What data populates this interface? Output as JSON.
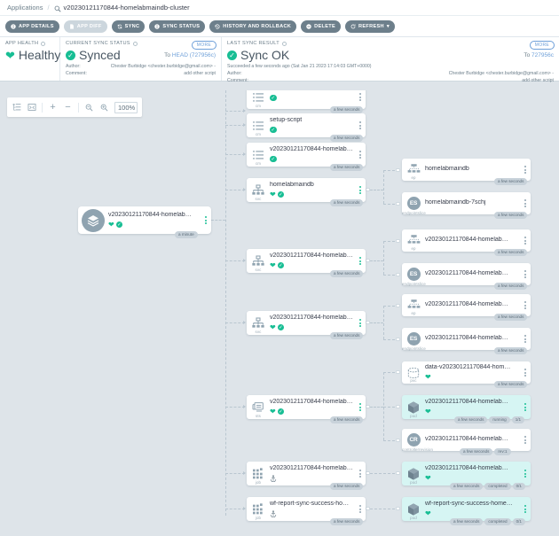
{
  "breadcrumb": {
    "root_label": "Applications",
    "separator": "/",
    "current": "v20230121170844-homelabmaindb-cluster",
    "search_icon": "magnifier-icon"
  },
  "toolbar": {
    "buttons": [
      {
        "label": "APP DETAILS",
        "icon": "info-icon",
        "disabled": false
      },
      {
        "label": "APP DIFF",
        "icon": "file-diff-icon",
        "disabled": true
      },
      {
        "label": "SYNC",
        "icon": "sync-icon",
        "disabled": false
      },
      {
        "label": "SYNC STATUS",
        "icon": "info-icon",
        "disabled": false
      },
      {
        "label": "HISTORY AND ROLLBACK",
        "icon": "history-icon",
        "disabled": false
      },
      {
        "label": "DELETE",
        "icon": "delete-icon",
        "disabled": false
      },
      {
        "label": "REFRESH",
        "icon": "refresh-icon",
        "disabled": false,
        "caret": "▾"
      }
    ]
  },
  "status": {
    "health": {
      "title": "APP HEALTH",
      "value": "Healthy",
      "icon": "heart-icon",
      "color": "#18be94"
    },
    "current_sync": {
      "title": "CURRENT SYNC STATUS",
      "more_label": "MORE",
      "value": "Synced",
      "icon": "check-circle-icon",
      "revision_prefix": "To",
      "revision": "HEAD (727956c)",
      "author_key": "Author:",
      "author_value": "Chester Burbidge <chester.burbidge@gmail.com> -",
      "comment_key": "Comment:",
      "comment_value": "add other script"
    },
    "last_sync": {
      "title": "LAST SYNC RESULT",
      "more_label": "MORE",
      "value": "Sync OK",
      "icon": "check-circle-icon",
      "revision_prefix": "To",
      "revision": "727956c",
      "succeeded": "Succeeded a few seconds ago (Sat Jan 21 2023 17:14:03 GMT+0000)",
      "author_key": "Author:",
      "author_value": "Chester Burbidge <chester.burbidge@gmail.com> -",
      "comment_key": "Comment:",
      "comment_value": "add other script"
    }
  },
  "zoombar": {
    "tree_icon": "tree-layout-icon",
    "fit_icon": "fit-to-screen-icon",
    "plus": "+",
    "minus": "−",
    "zoom_out_icon": "zoom-out-icon",
    "zoom_in_icon": "zoom-in-icon",
    "zoom_level": "100%"
  },
  "graph": {
    "root": {
      "name": "v20230121170844-homelab…",
      "kind_icon": "layers-icon",
      "health": "heart-icon",
      "sync": "check-circle-icon",
      "age": "a minute"
    },
    "nodes": [
      {
        "id": "cm0",
        "name": "",
        "kind": "cm",
        "icon": "configmap-icon",
        "health": "",
        "sync": "check-circle-icon",
        "age": "a few seconds",
        "clipped": true
      },
      {
        "id": "cm1",
        "name": "setup-script",
        "kind": "cm",
        "icon": "configmap-icon",
        "health": "",
        "sync": "check-circle-icon",
        "age": "a few seconds"
      },
      {
        "id": "cm2",
        "name": "v20230121170844-homelab…",
        "kind": "cm",
        "icon": "configmap-icon",
        "health": "",
        "sync": "check-circle-icon",
        "age": "a few seconds"
      },
      {
        "id": "svc0",
        "name": "homelabmaindb",
        "kind": "svc",
        "icon": "service-icon",
        "health": "heart-icon",
        "sync": "check-circle-icon",
        "age": "a few seconds"
      },
      {
        "id": "svc1",
        "name": "v20230121170844-homelab…",
        "kind": "svc",
        "icon": "service-icon",
        "health": "heart-icon",
        "sync": "check-circle-icon",
        "age": "a few seconds"
      },
      {
        "id": "svc2",
        "name": "v20230121170844-homelab…",
        "kind": "svc",
        "icon": "service-icon",
        "health": "heart-icon",
        "sync": "check-circle-icon",
        "age": "a few seconds"
      },
      {
        "id": "sts0",
        "name": "v20230121170844-homelab…",
        "kind": "sts",
        "icon": "statefulset-icon",
        "health": "heart-icon",
        "sync": "check-circle-icon",
        "age": "a few seconds"
      },
      {
        "id": "job0",
        "name": "v20230121170844-homelab…",
        "kind": "job",
        "icon": "job-icon",
        "health": "anchor-icon",
        "sync": "",
        "age": "a few seconds"
      },
      {
        "id": "job1",
        "name": "wf-report-sync-success-home…",
        "kind": "job",
        "icon": "job-icon",
        "health": "anchor-icon",
        "sync": "",
        "age": "a few seconds"
      },
      {
        "id": "ep0",
        "name": "homelabmaindb",
        "kind": "ep",
        "icon": "endpoints-icon",
        "health": "",
        "sync": "",
        "age": "a few seconds"
      },
      {
        "id": "es0",
        "name": "homelabmaindb-7schj",
        "kind": "endpointslice",
        "icon": "ES",
        "health": "",
        "sync": "",
        "age": "a few seconds"
      },
      {
        "id": "ep1",
        "name": "v20230121170844-homelab…",
        "kind": "ep",
        "icon": "endpoints-icon",
        "health": "",
        "sync": "",
        "age": "a few seconds"
      },
      {
        "id": "es1",
        "name": "v20230121170844-homelab…",
        "kind": "endpointslice",
        "icon": "ES",
        "health": "",
        "sync": "",
        "age": "a few seconds"
      },
      {
        "id": "ep2",
        "name": "v20230121170844-homelab…",
        "kind": "ep",
        "icon": "endpoints-icon",
        "health": "",
        "sync": "",
        "age": "a few seconds"
      },
      {
        "id": "es2",
        "name": "v20230121170844-homelab…",
        "kind": "endpointslice",
        "icon": "ES",
        "health": "",
        "sync": "",
        "age": "a few seconds"
      },
      {
        "id": "pvc0",
        "name": "data-v20230121170844-hom…",
        "kind": "pvc",
        "icon": "pvc-icon",
        "health": "heart-icon",
        "sync": "",
        "age": "a few seconds"
      },
      {
        "id": "pod0",
        "name": "v20230121170844-homelab…",
        "kind": "pod",
        "icon": "pod-icon",
        "health": "heart-icon",
        "sync": "",
        "age": "a few seconds",
        "highlight": true,
        "extra": [
          "running",
          "1/1"
        ]
      },
      {
        "id": "cr0",
        "name": "v20230121170844-homelab…",
        "kind": "controllerrevision",
        "icon": "CR",
        "health": "",
        "sync": "",
        "age": "a few seconds",
        "extra": [
          "rev:1"
        ]
      },
      {
        "id": "pod1",
        "name": "v20230121170844-homelab…",
        "kind": "pod",
        "icon": "pod-icon",
        "health": "heart-icon",
        "sync": "",
        "age": "a few seconds",
        "highlight": true,
        "extra": [
          "completed",
          "0/1"
        ]
      },
      {
        "id": "pod2",
        "name": "wf-report-sync-success-home…",
        "kind": "pod",
        "icon": "pod-icon",
        "health": "heart-icon",
        "sync": "",
        "age": "a few seconds",
        "highlight": true,
        "extra": [
          "completed",
          "0/1"
        ]
      }
    ]
  },
  "colors": {
    "healthy_green": "#18be94",
    "link_blue": "#6d9fd8",
    "canvas_bg": "#dee4e9",
    "toolbar_btn": "#6d7f8b",
    "highlight_cyan": "#d6f5f3"
  }
}
